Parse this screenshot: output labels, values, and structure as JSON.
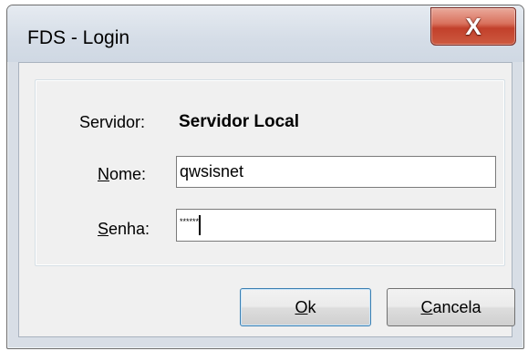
{
  "window": {
    "title": "FDS - Login",
    "close_glyph": "X"
  },
  "form": {
    "server_label": "Servidor:",
    "server_value": "Servidor Local",
    "name_label_accel": "N",
    "name_label_rest": "ome:",
    "name_value": "qwsisnet",
    "password_label_accel": "S",
    "password_label_rest": "enha:",
    "password_mask": "******"
  },
  "buttons": {
    "ok_accel": "O",
    "ok_rest": "k",
    "cancel_accel": "C",
    "cancel_rest": "ancela"
  },
  "colors": {
    "close_button": "#c2402b",
    "window_frame": "#d8dee6",
    "client_bg": "#f0f0f0",
    "default_button_border": "#3c7fb1"
  },
  "icons": {
    "close": "close-icon"
  }
}
